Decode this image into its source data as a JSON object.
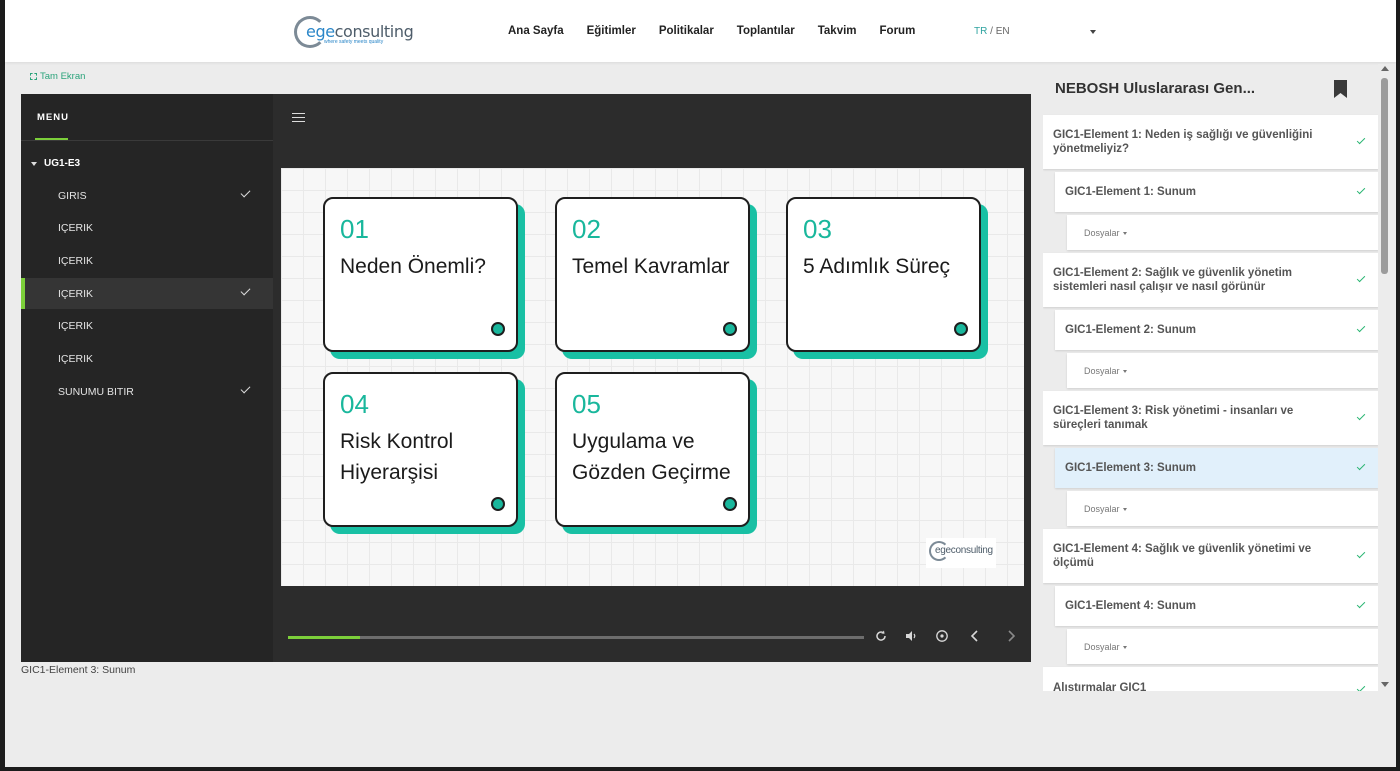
{
  "header": {
    "logo_word_prefix": "ege",
    "logo_word_suffix": "consulting",
    "logo_tagline": "where safety meets quality",
    "nav": [
      "Ana Sayfa",
      "Eğitimler",
      "Politikalar",
      "Toplantılar",
      "Takvim",
      "Forum"
    ],
    "lang_tr": "TR",
    "lang_sep": " / ",
    "lang_en": "EN"
  },
  "fullscreen_label": "Tam Ekran",
  "player": {
    "menu_title": "MENU",
    "group_label": "UG1-E3",
    "items": [
      {
        "label": "GIRIS",
        "checked": true,
        "active": false
      },
      {
        "label": "IÇERIK",
        "checked": false,
        "active": false
      },
      {
        "label": "IÇERIK",
        "checked": false,
        "active": false
      },
      {
        "label": "IÇERIK",
        "checked": true,
        "active": true
      },
      {
        "label": "IÇERIK",
        "checked": false,
        "active": false
      },
      {
        "label": "IÇERIK",
        "checked": false,
        "active": false
      },
      {
        "label": "SUNUMU BITIR",
        "checked": true,
        "active": false
      }
    ],
    "slide": {
      "cards": [
        {
          "num": "01",
          "title": "Neden Önemli?"
        },
        {
          "num": "02",
          "title": "Temel Kavramlar"
        },
        {
          "num": "03",
          "title": "5 Adımlık Süreç"
        },
        {
          "num": "04",
          "title": "Risk Kontrol Hiyerarşisi"
        },
        {
          "num": "05",
          "title": "Uygulama ve Gözden Geçirme"
        }
      ],
      "logo_word": "egeconsulting"
    },
    "progress_fraction": 0.125,
    "controls": [
      "replay-icon",
      "volume-icon",
      "speed-icon",
      "prev-icon",
      "next-icon"
    ]
  },
  "caption": "GIC1-Element 3: Sunum",
  "course": {
    "title": "NEBOSH Uluslararası Gen...",
    "sections": [
      {
        "title": "GIC1-Element 1: Neden iş sağlığı ve güvenliğini yönetmeliyiz?",
        "sub": "GIC1-Element 1: Sunum",
        "files": "Dosyalar"
      },
      {
        "title": "GIC1-Element 2: Sağlık ve güvenlik yönetim sistemleri nasıl çalışır ve nasıl görünür",
        "sub": "GIC1-Element 2: Sunum",
        "files": "Dosyalar"
      },
      {
        "title": "GIC1-Element 3: Risk yönetimi - insanları ve süreçleri tanımak",
        "sub": "GIC1-Element 3: Sunum",
        "files": "Dosyalar"
      },
      {
        "title": "GIC1-Element 4: Sağlık ve güvenlik yönetimi ve ölçümü",
        "sub": "GIC1-Element 4: Sunum",
        "files": "Dosyalar"
      }
    ],
    "last_section": "Alıstırmalar GIC1",
    "selected_sub": "GIC1-Element 3: Sunum"
  },
  "colors": {
    "accent_green": "#7ccf3a",
    "teal": "#19b79c",
    "check_green": "#2bb673",
    "selected_bg": "#e1f0fb"
  }
}
